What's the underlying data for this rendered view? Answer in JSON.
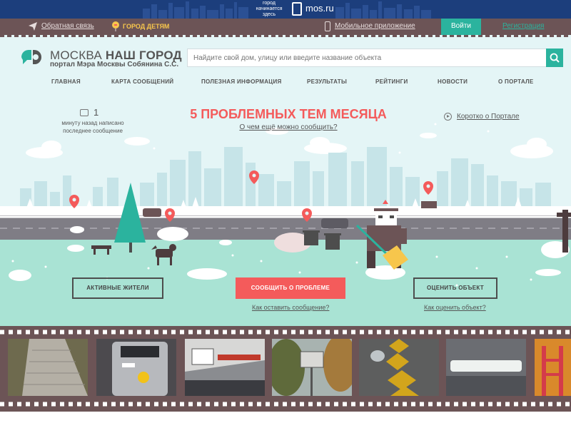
{
  "topbar": {
    "slogan": "город начинается здесь",
    "portal": "mos.ru"
  },
  "utilbar": {
    "feedback": "Обратная связь",
    "kids": "ГОРОД ДЕТЯМ",
    "mobile_app": "Мобильное приложение",
    "login": "Войти",
    "register": "Регистрация"
  },
  "header": {
    "logo_title_light": "МОСКВА ",
    "logo_title_bold": "НАШ ГОРОД",
    "logo_subtitle": "портал Мэра Москвы Собянина С.С.",
    "search_placeholder": "Найдите свой дом, улицу или введите название объекта",
    "nav": [
      "ГЛАВНАЯ",
      "КАРТА СООБЩЕНИЙ",
      "ПОЛЕЗНАЯ ИНФОРМАЦИЯ",
      "РЕЗУЛЬТАТЫ",
      "РЕЙТИНГИ",
      "НОВОСТИ",
      "О ПОРТАЛЕ"
    ]
  },
  "hero": {
    "counter_value": "1",
    "counter_text": "минуту назад написано последнее сообщение",
    "title": "5 ПРОБЛЕМНЫХ ТЕМ МЕСЯЦА",
    "subtitle": "О чем ещё можно сообщить?",
    "about_link": "Коротко о Портале",
    "btn_active_residents": "АКТИВНЫЕ ЖИТЕЛИ",
    "btn_report": "СООБЩИТЬ О ПРОБЛЕМЕ",
    "btn_rate": "ОЦЕНИТЬ ОБЪЕКТ",
    "hint_report": "Как оставить сообщение?",
    "hint_rate": "Как оценить объект?"
  },
  "colors": {
    "accent_red": "#f45b5b",
    "accent_teal": "#2bb39e",
    "bar_brown": "#6c5456",
    "top_blue": "#1c3e7c",
    "hero_bg": "#e4f5f6",
    "ground": "#a9e3d4"
  },
  "film_photos": [
    "sidewalk",
    "ticket-validator",
    "train-display",
    "basketball-hoop",
    "tactile-paving",
    "lamp",
    "playground"
  ]
}
